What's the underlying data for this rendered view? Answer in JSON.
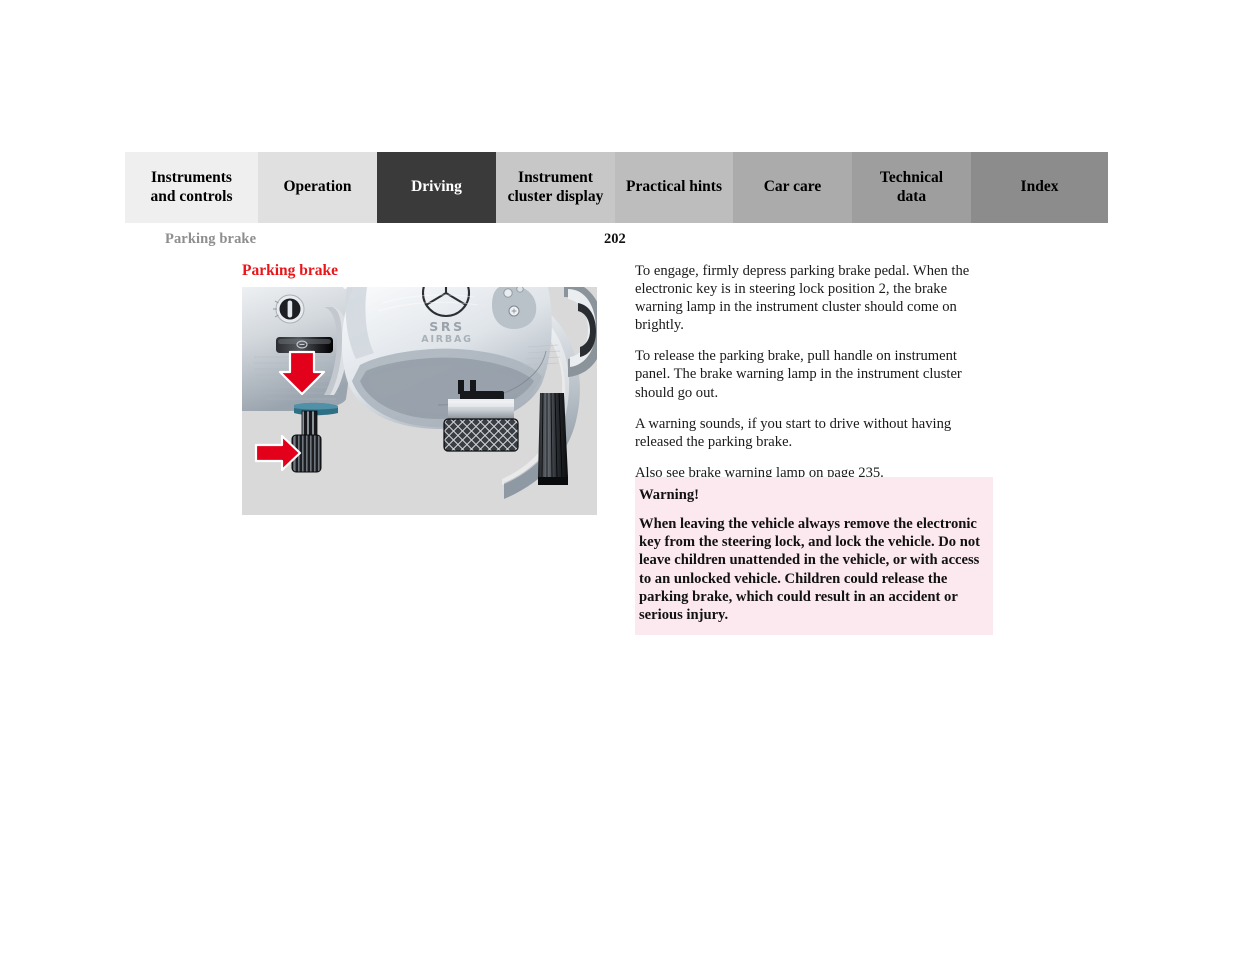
{
  "tabs": [
    {
      "label": "Instruments\nand controls",
      "name": "tab-instruments-and-controls",
      "bg": "#efefef",
      "active": false
    },
    {
      "label": "Operation",
      "name": "tab-operation",
      "bg": "#e0e0e0",
      "active": false
    },
    {
      "label": "Driving",
      "name": "tab-driving",
      "bg": "#3a3a3a",
      "active": true
    },
    {
      "label": "Instrument\ncluster display",
      "name": "tab-instrument-cluster-display",
      "bg": "#c7c7c7",
      "active": false
    },
    {
      "label": "Practical hints",
      "name": "tab-practical-hints",
      "bg": "#bdbdbd",
      "active": false
    },
    {
      "label": "Car care",
      "name": "tab-car-care",
      "bg": "#ababab",
      "active": false
    },
    {
      "label": "Technical\ndata",
      "name": "tab-technical-data",
      "bg": "#9e9e9e",
      "active": false
    },
    {
      "label": "Index",
      "name": "tab-index",
      "bg": "#8c8c8c",
      "active": false
    }
  ],
  "header": {
    "running_head": "Parking brake",
    "page_number": "202"
  },
  "content": {
    "section_title": "Parking brake",
    "paragraphs": [
      "To engage, firmly depress parking brake pedal. When the electronic key is in steering lock position 2, the brake warning lamp in the instrument cluster should come on brightly.",
      "To release the parking brake, pull handle on instrument panel. The brake warning lamp in the instrument cluster should go out.",
      "A warning sounds, if you start to drive without having released the parking brake.",
      "Also see brake warning lamp on page 235."
    ]
  },
  "warning": {
    "title": "Warning!",
    "body": "When leaving the vehicle always remove the electronic key from the steering lock, and lock the vehicle. Do not leave children unattended in the vehicle, or with access to an unlocked vehicle. Children could release the parking brake, which could result in an accident or serious injury."
  },
  "illustration": {
    "caption": "Driver footwell with steering wheel, parking brake pedal and release handle",
    "steering_wheel_text": "SRS AIRBAG",
    "arrow_color": "#e2001a",
    "background": "#d9d9d9",
    "callouts": [
      {
        "name": "parking-brake-release-handle-arrow",
        "direction": "down"
      },
      {
        "name": "parking-brake-pedal-arrow",
        "direction": "right"
      }
    ]
  },
  "colors": {
    "accent_red": "#e8161b",
    "warning_bg": "#fce9ef",
    "running_head": "#8e8e8e",
    "active_tab_bg": "#3a3a3a"
  }
}
